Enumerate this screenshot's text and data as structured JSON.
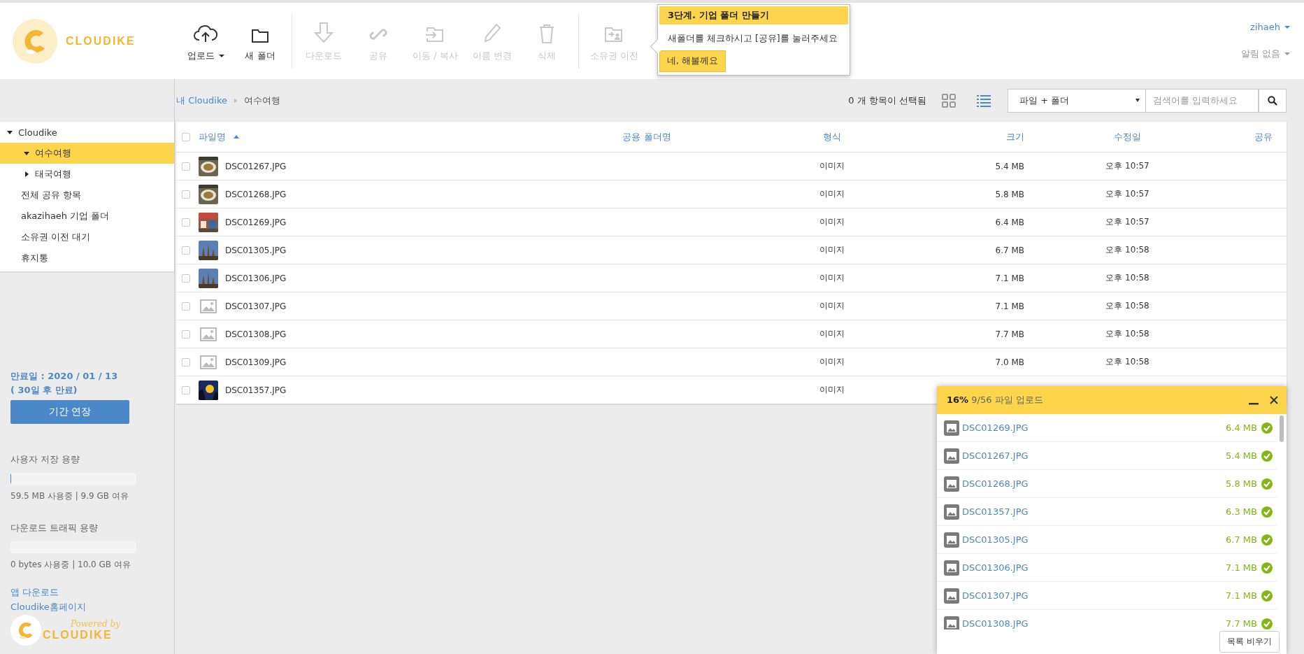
{
  "logo": {
    "text": "CLOUDIKE"
  },
  "toolbar_groups": [
    {
      "tools": [
        {
          "label": "업로드",
          "disabled": false,
          "dropdown": true
        },
        {
          "label": "새 폴더",
          "disabled": false
        }
      ]
    },
    {
      "tools": [
        {
          "label": "다운로드",
          "disabled": true
        },
        {
          "label": "공유",
          "disabled": true
        },
        {
          "label": "이동 / 복사",
          "disabled": true
        },
        {
          "label": "이름 변경",
          "disabled": true
        },
        {
          "label": "삭제",
          "disabled": true
        }
      ]
    },
    {
      "tools": [
        {
          "label": "소유권 이전",
          "disabled": true
        }
      ]
    }
  ],
  "tooltip": {
    "title": "3단계. 기업 폴더 만들기",
    "body": "새폴더를 체크하시고 [공유]를 눌러주세요",
    "button": "네, 해볼께요"
  },
  "user_menu": {
    "user": "zihaeh",
    "notifications": "알림 없음"
  },
  "breadcrumb": [
    "내 Cloudike",
    "여수여행"
  ],
  "selection_count": "0 개 항목이 선택됨",
  "view_toggles": [
    {
      "kind": "grid",
      "selected": false
    },
    {
      "kind": "list",
      "selected": true
    }
  ],
  "filter_select": {
    "value": "파일 + 폴더"
  },
  "search": {
    "placeholder": "검색어를 입력하세요"
  },
  "sidebar": {
    "tree": [
      {
        "label": "Cloudike",
        "expanded": true,
        "selected": false,
        "children": [
          {
            "label": "여수여행",
            "expanded": true,
            "selected": true
          },
          {
            "label": "태국여행",
            "expanded": false,
            "selected": false
          }
        ]
      }
    ],
    "items": [
      {
        "label": "전체 공유 항목",
        "selected": false
      },
      {
        "label": "akazihaeh 기업 폴더",
        "selected": false
      },
      {
        "label": "소유권 이전 대기",
        "selected": false
      },
      {
        "label": "휴지통",
        "selected": false
      }
    ],
    "expiry": "만료일 : 2020 / 01 / 13",
    "expiry_note": "( 30일 후 만료)",
    "extend_button": "기간 연장",
    "meters": [
      {
        "title": "사용자 저장 용량",
        "level": 0.006,
        "reading": "59.5 MB 사용중 | 9.9 GB 여유"
      },
      {
        "title": "다운로드 트래픽 용량",
        "level": 0,
        "reading": "0 bytes 사용중 | 10.0 GB 여유"
      }
    ],
    "links": [
      "앱 다운로드",
      "Cloudike홈페이지"
    ],
    "powered_by": "Powered by",
    "powered_logo": "CLOUDIKE"
  },
  "table": {
    "select_all": {
      "checked": false
    },
    "columns": [
      {
        "label": "파일명",
        "sort_ascending": true
      },
      {
        "label": "공용 폴더명"
      },
      {
        "label": "형식"
      },
      {
        "label": "크기"
      },
      {
        "label": "수정일"
      },
      {
        "label": "공유"
      }
    ],
    "rows": [
      {
        "checked": false,
        "name": "DSC01267.JPG",
        "type": "이미지",
        "size": "5.4 MB",
        "modified": "오후 10:57"
      },
      {
        "checked": false,
        "name": "DSC01268.JPG",
        "type": "이미지",
        "size": "5.8 MB",
        "modified": "오후 10:57"
      },
      {
        "checked": false,
        "name": "DSC01269.JPG",
        "type": "이미지",
        "size": "6.4 MB",
        "modified": "오후 10:57"
      },
      {
        "checked": false,
        "name": "DSC01305.JPG",
        "type": "이미지",
        "size": "6.7 MB",
        "modified": "오후 10:58"
      },
      {
        "checked": false,
        "name": "DSC01306.JPG",
        "type": "이미지",
        "size": "7.1 MB",
        "modified": "오후 10:58"
      },
      {
        "checked": false,
        "kind": "placeholder",
        "name": "DSC01307.JPG",
        "type": "이미지",
        "size": "7.1 MB",
        "modified": "오후 10:58"
      },
      {
        "checked": false,
        "kind": "placeholder",
        "name": "DSC01308.JPG",
        "type": "이미지",
        "size": "7.7 MB",
        "modified": "오후 10:58"
      },
      {
        "checked": false,
        "kind": "placeholder",
        "name": "DSC01309.JPG",
        "type": "이미지",
        "size": "7.0 MB",
        "modified": "오후 10:58"
      },
      {
        "checked": false,
        "name": "DSC01357.JPG",
        "type": "이미지"
      }
    ]
  },
  "upload_panel": {
    "percent": "16%",
    "status": "9/56 파일 업로드",
    "clear_button": "목록 비우기",
    "items": [
      {
        "name": "DSC01269.JPG",
        "size": "6.4 MB",
        "done": true
      },
      {
        "name": "DSC01267.JPG",
        "size": "5.4 MB",
        "done": true
      },
      {
        "name": "DSC01268.JPG",
        "size": "5.8 MB",
        "done": true
      },
      {
        "name": "DSC01357.JPG",
        "size": "6.3 MB",
        "done": true
      },
      {
        "name": "DSC01305.JPG",
        "size": "6.7 MB",
        "done": true
      },
      {
        "name": "DSC01306.JPG",
        "size": "7.1 MB",
        "done": true
      },
      {
        "name": "DSC01307.JPG",
        "size": "7.1 MB",
        "done": true
      },
      {
        "name": "DSC01308.JPG",
        "size": "7.7 MB",
        "done": true
      }
    ]
  }
}
